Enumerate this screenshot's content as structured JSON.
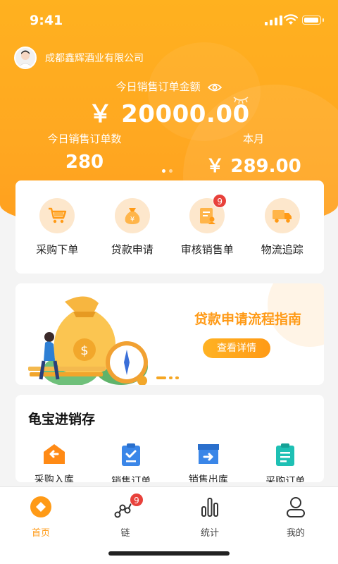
{
  "status_bar": {
    "time": "9:41"
  },
  "header": {
    "company": "成都鑫辉酒业有限公司"
  },
  "today": {
    "amount_label": "今日销售订单金额",
    "amount": "￥ 20000.00",
    "orders_label": "今日销售订单数",
    "orders_value": "280",
    "month_label": "本月",
    "month_value": "￥ 289.00"
  },
  "carousel": {
    "count": 2,
    "active": 1
  },
  "quick_actions": [
    {
      "label": "采购下单",
      "icon": "cart-icon"
    },
    {
      "label": "贷款申请",
      "icon": "money-bag-icon"
    },
    {
      "label": "审核销售单",
      "icon": "review-document-icon",
      "badge": "9"
    },
    {
      "label": "物流追踪",
      "icon": "truck-icon"
    }
  ],
  "banner": {
    "title": "贷款申请流程指南",
    "button": "查看详情"
  },
  "inventory": {
    "title": "龟宝进销存",
    "items": [
      {
        "label": "采购入库",
        "icon": "inbound-icon"
      },
      {
        "label": "销售订单",
        "icon": "sales-order-icon"
      },
      {
        "label": "销售出库",
        "icon": "outbound-icon"
      },
      {
        "label": "采购订单",
        "icon": "purchase-order-icon"
      }
    ]
  },
  "tabs": [
    {
      "label": "首页",
      "icon": "home-icon",
      "active": true
    },
    {
      "label": "链",
      "icon": "chain-icon",
      "badge": "9"
    },
    {
      "label": "统计",
      "icon": "stats-icon"
    },
    {
      "label": "我的",
      "icon": "profile-icon"
    }
  ],
  "colors": {
    "accent": "#ff9a16",
    "hero": "#ffab20",
    "badge": "#e8413b"
  }
}
